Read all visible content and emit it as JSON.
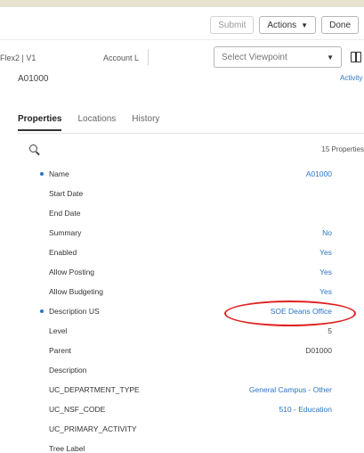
{
  "toolbar": {
    "submit_label": "Submit",
    "actions_label": "Actions",
    "done_label": "Done"
  },
  "header": {
    "breadcrumb": "Flex2 | V1",
    "account_label": "Account L",
    "viewpoint_placeholder": "Select Viewpoint",
    "node_name": "A01000",
    "activity_link": "Activity"
  },
  "tabs": [
    {
      "label": "Properties",
      "active": true
    },
    {
      "label": "Locations",
      "active": false
    },
    {
      "label": "History",
      "active": false
    }
  ],
  "properties_count": "15 Properties",
  "properties": [
    {
      "label": "Name",
      "value": "A01000",
      "required": true,
      "link": true
    },
    {
      "label": "Start Date",
      "value": "",
      "required": false,
      "link": false
    },
    {
      "label": "End Date",
      "value": "",
      "required": false,
      "link": false
    },
    {
      "label": "Summary",
      "value": "No",
      "required": false,
      "link": true
    },
    {
      "label": "Enabled",
      "value": "Yes",
      "required": false,
      "link": true
    },
    {
      "label": "Allow Posting",
      "value": "Yes",
      "required": false,
      "link": true
    },
    {
      "label": "Allow Budgeting",
      "value": "Yes",
      "required": false,
      "link": true
    },
    {
      "label": "Description US",
      "value": "SOE Deans Office",
      "required": true,
      "link": true
    },
    {
      "label": "Level",
      "value": "5",
      "required": false,
      "link": false
    },
    {
      "label": "Parent",
      "value": "D01000",
      "required": false,
      "link": false
    },
    {
      "label": "Description",
      "value": "",
      "required": false,
      "link": false
    },
    {
      "label": "UC_DEPARTMENT_TYPE",
      "value": "General Campus - Other",
      "required": false,
      "link": true
    },
    {
      "label": "UC_NSF_CODE",
      "value": "510 - Education",
      "required": false,
      "link": true
    },
    {
      "label": "UC_PRIMARY_ACTIVITY",
      "value": "",
      "required": false,
      "link": false
    },
    {
      "label": "Tree Label",
      "value": "",
      "required": false,
      "link": false
    }
  ],
  "colors": {
    "link": "#2d74c4",
    "annotation": "#e02121",
    "background": "#e7e3d0"
  }
}
